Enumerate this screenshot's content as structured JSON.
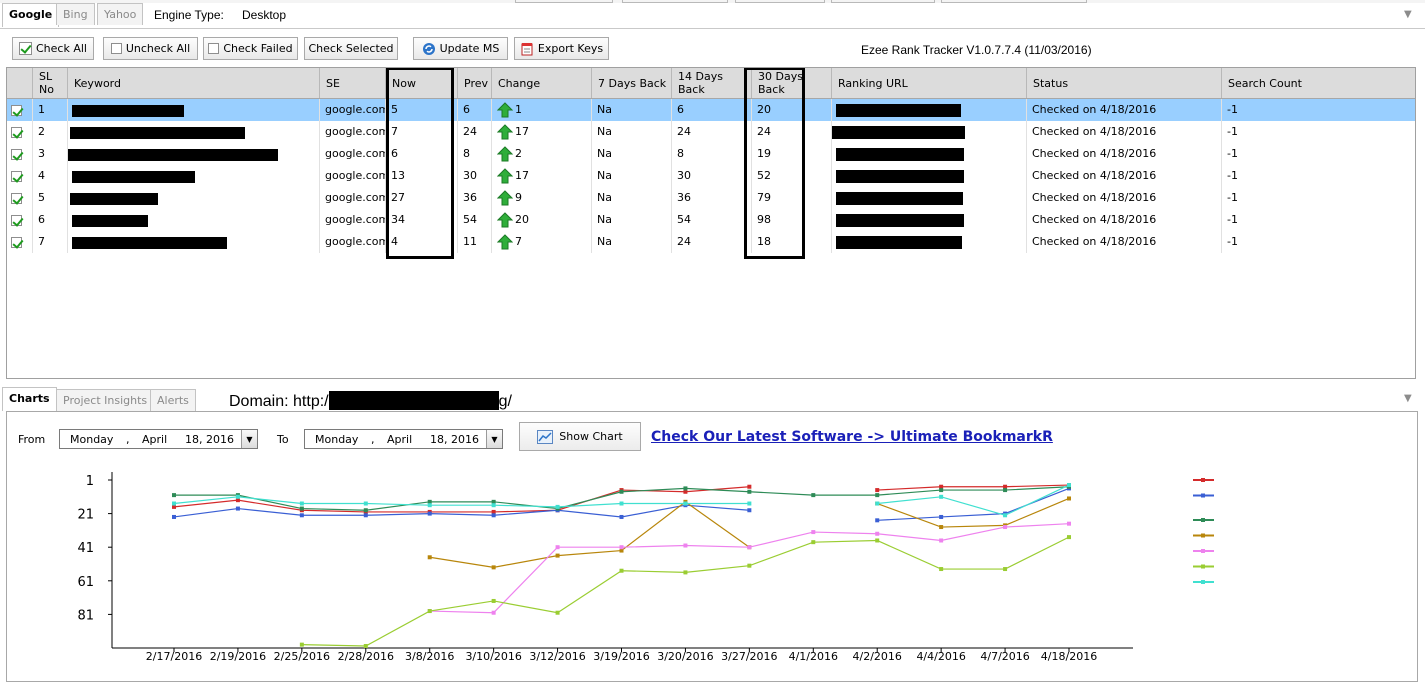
{
  "engine_tabs": [
    "Google",
    "Bing",
    "Yahoo"
  ],
  "engine_type_label": "Engine Type:",
  "engine_type_value": "Desktop",
  "toolbar": {
    "check_all": "Check All",
    "uncheck_all": "Uncheck All",
    "check_failed": "Check Failed",
    "check_selected": "Check Selected",
    "update_ms": "Update MS",
    "export_keys": "Export Keys"
  },
  "version": "Ezee Rank Tracker V1.0.7.7.4 (11/03/2016)",
  "table": {
    "headers": [
      "SL No",
      "Keyword",
      "SE",
      "Now",
      "Prev",
      "Change",
      "7 Days Back",
      "14 Days Back",
      "30 Days Back",
      "Ranking URL",
      "Status",
      "Search Count"
    ],
    "rows": [
      {
        "sl": "1",
        "se": "google.com",
        "now": "5",
        "prev": "6",
        "change": "1",
        "d7": "Na",
        "d14": "6",
        "d30": "20",
        "status": "Checked on 4/18/2016",
        "count": "-1"
      },
      {
        "sl": "2",
        "se": "google.com",
        "now": "7",
        "prev": "24",
        "change": "17",
        "d7": "Na",
        "d14": "24",
        "d30": "24",
        "status": "Checked on 4/18/2016",
        "count": "-1"
      },
      {
        "sl": "3",
        "se": "google.com",
        "now": "6",
        "prev": "8",
        "change": "2",
        "d7": "Na",
        "d14": "8",
        "d30": "19",
        "status": "Checked on 4/18/2016",
        "count": "-1"
      },
      {
        "sl": "4",
        "se": "google.com",
        "now": "13",
        "prev": "30",
        "change": "17",
        "d7": "Na",
        "d14": "30",
        "d30": "52",
        "status": "Checked on 4/18/2016",
        "count": "-1"
      },
      {
        "sl": "5",
        "se": "google.com",
        "now": "27",
        "prev": "36",
        "change": "9",
        "d7": "Na",
        "d14": "36",
        "d30": "79",
        "status": "Checked on 4/18/2016",
        "count": "-1"
      },
      {
        "sl": "6",
        "se": "google.com",
        "now": "34",
        "prev": "54",
        "change": "20",
        "d7": "Na",
        "d14": "54",
        "d30": "98",
        "status": "Checked on 4/18/2016",
        "count": "-1"
      },
      {
        "sl": "7",
        "se": "google.com",
        "now": "4",
        "prev": "11",
        "change": "7",
        "d7": "Na",
        "d14": "24",
        "d30": "18",
        "status": "Checked on 4/18/2016",
        "count": "-1"
      }
    ]
  },
  "bottom_tabs": [
    "Charts",
    "Project Insights",
    "Alerts"
  ],
  "domain_label": "Domain: http:/",
  "domain_suffix": "g/",
  "from_label": "From",
  "to_label": "To",
  "from_date": {
    "day": "Monday",
    "month": "April",
    "date": "18, 2016"
  },
  "to_date": {
    "day": "Monday",
    "month": "April",
    "date": "18, 2016"
  },
  "show_chart": "Show Chart",
  "promo_link": "Check Our Latest Software -> Ultimate BookmarkR",
  "chart_data": {
    "type": "line",
    "categories": [
      "2/17/2016",
      "2/19/2016",
      "2/25/2016",
      "2/28/2016",
      "3/8/2016",
      "3/10/2016",
      "3/12/2016",
      "3/19/2016",
      "3/20/2016",
      "3/27/2016",
      "4/1/2016",
      "4/2/2016",
      "4/4/2016",
      "4/7/2016",
      "4/18/2016"
    ],
    "ylim": [
      1,
      101
    ],
    "yticks": [
      1,
      21,
      41,
      61,
      81
    ],
    "series": [
      {
        "color": "#d42b2b",
        "values": [
          17,
          13,
          19,
          20,
          20,
          20,
          19,
          7,
          8,
          5,
          null,
          7,
          5,
          5,
          4
        ]
      },
      {
        "color": "#3a5fd4",
        "values": [
          23,
          18,
          22,
          22,
          21,
          22,
          19,
          23,
          16,
          19,
          null,
          25,
          23,
          21,
          6
        ]
      },
      {
        "color": "#2e8b57",
        "values": [
          10,
          10,
          18,
          19,
          14,
          14,
          18,
          8,
          6,
          8,
          10,
          10,
          7,
          7,
          5
        ]
      },
      {
        "color": "#b8860b",
        "values": [
          null,
          null,
          null,
          null,
          47,
          53,
          46,
          43,
          14,
          41,
          null,
          15,
          29,
          28,
          12
        ]
      },
      {
        "color": "#ee82ee",
        "values": [
          null,
          null,
          null,
          null,
          79,
          80,
          41,
          41,
          40,
          41,
          32,
          33,
          37,
          29,
          27
        ]
      },
      {
        "color": "#9acd32",
        "values": [
          null,
          null,
          99,
          102,
          79,
          73,
          80,
          55,
          56,
          52,
          38,
          37,
          54,
          54,
          35
        ]
      },
      {
        "color": "#40e0d0",
        "values": [
          15,
          11,
          15,
          15,
          16,
          16,
          17,
          15,
          15,
          15,
          null,
          15,
          11,
          22,
          4
        ]
      }
    ]
  }
}
